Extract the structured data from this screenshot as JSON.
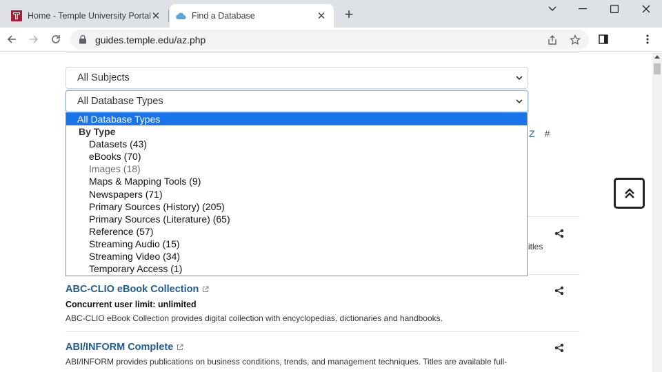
{
  "browser": {
    "tabs": [
      {
        "title": "Home - Temple University Portal",
        "active": false
      },
      {
        "title": "Find a Database",
        "active": true
      }
    ],
    "url": "guides.temple.edu/az.php"
  },
  "filters": {
    "subjects_value": "All Subjects",
    "types_value": "All Database Types"
  },
  "az_letters": [
    "Z",
    "#"
  ],
  "dropdown": {
    "selected": "All Database Types",
    "group_label": "By Type",
    "options": [
      "Datasets (43)",
      "eBooks (70)",
      "Images (18)",
      "Maps & Mapping Tools (9)",
      "Newspapers (71)",
      "Primary Sources (History) (205)",
      "Primary Sources (Literature) (65)",
      "Reference (57)",
      "Streaming Audio (15)",
      "Streaming Video (34)",
      "Temporary Access (1)"
    ]
  },
  "partial_text": "itles",
  "databases": [
    {
      "title": "ABC-CLIO eBook Collection",
      "subtitle": "Concurrent user limit: unlimited",
      "description": "ABC-CLIO eBook Collection provides digital collection with encyclopedias, dictionaries and handbooks."
    },
    {
      "title": "ABI/INFORM Complete",
      "description": "ABI/INFORM provides publications on business conditions, trends, and management techniques. Titles are available full-"
    }
  ],
  "colors": {
    "link": "#1f5c92",
    "selected_option": "#1a73e8",
    "tab_bar": "#dee1e6",
    "temple_red": "#a41e35"
  }
}
